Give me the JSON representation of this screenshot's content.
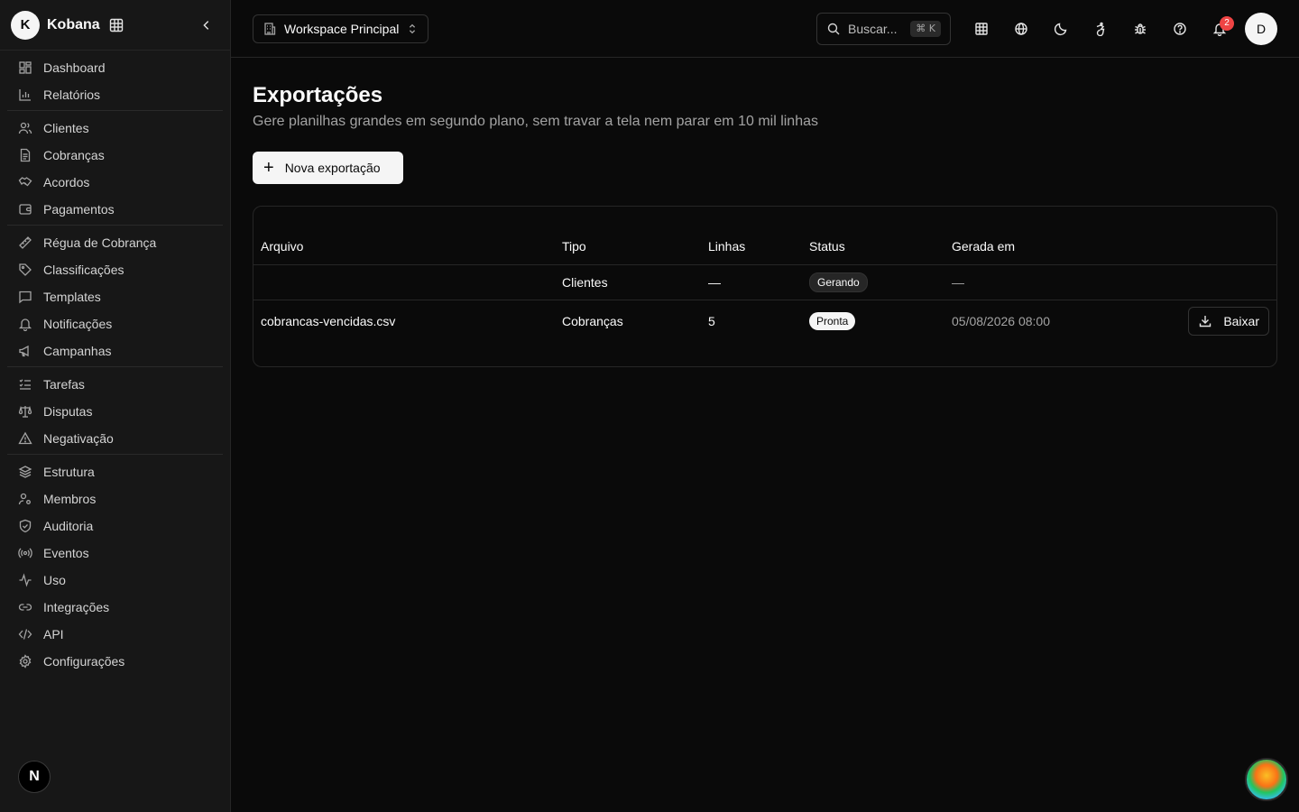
{
  "brand": {
    "initial": "K",
    "name": "Kobana"
  },
  "sidebar": {
    "groups": [
      {
        "items": [
          {
            "label": "Dashboard",
            "icon": "dashboard-icon"
          },
          {
            "label": "Relatórios",
            "icon": "bar-chart-icon"
          }
        ]
      },
      {
        "items": [
          {
            "label": "Clientes",
            "icon": "users-icon"
          },
          {
            "label": "Cobranças",
            "icon": "file-icon"
          },
          {
            "label": "Acordos",
            "icon": "handshake-icon"
          },
          {
            "label": "Pagamentos",
            "icon": "wallet-icon"
          }
        ]
      },
      {
        "items": [
          {
            "label": "Régua de Cobrança",
            "icon": "ruler-icon"
          },
          {
            "label": "Classificações",
            "icon": "tag-icon"
          },
          {
            "label": "Templates",
            "icon": "message-icon"
          },
          {
            "label": "Notificações",
            "icon": "bell-icon"
          },
          {
            "label": "Campanhas",
            "icon": "megaphone-icon"
          }
        ]
      },
      {
        "items": [
          {
            "label": "Tarefas",
            "icon": "list-checks-icon"
          },
          {
            "label": "Disputas",
            "icon": "scale-icon"
          },
          {
            "label": "Negativação",
            "icon": "alert-triangle-icon"
          }
        ]
      },
      {
        "items": [
          {
            "label": "Estrutura",
            "icon": "layers-icon"
          },
          {
            "label": "Membros",
            "icon": "user-cog-icon"
          },
          {
            "label": "Auditoria",
            "icon": "shield-icon"
          },
          {
            "label": "Eventos",
            "icon": "radio-icon"
          },
          {
            "label": "Uso",
            "icon": "activity-icon"
          },
          {
            "label": "Integrações",
            "icon": "link-icon"
          },
          {
            "label": "API",
            "icon": "code-icon"
          },
          {
            "label": "Configurações",
            "icon": "gear-icon"
          }
        ]
      }
    ],
    "footer_badge": "N"
  },
  "topbar": {
    "workspace": "Workspace Principal",
    "search_placeholder": "Buscar...",
    "search_shortcut": "⌘ K",
    "notification_count": "2",
    "avatar_initial": "D"
  },
  "page": {
    "title": "Exportações",
    "subtitle": "Gere planilhas grandes em segundo plano, sem travar a tela nem parar em 10 mil linhas",
    "new_button": "Nova exportação"
  },
  "table": {
    "headers": {
      "file": "Arquivo",
      "type": "Tipo",
      "lines": "Linhas",
      "status": "Status",
      "date": "Gerada em"
    },
    "rows": [
      {
        "file": "",
        "type": "Clientes",
        "lines": "—",
        "status": "Gerando",
        "date": "—"
      },
      {
        "file": "cobrancas-vencidas.csv",
        "type": "Cobranças",
        "lines": "5",
        "status": "Pronta",
        "date": "05/08/2026 08:00",
        "action": "Baixar"
      }
    ]
  }
}
